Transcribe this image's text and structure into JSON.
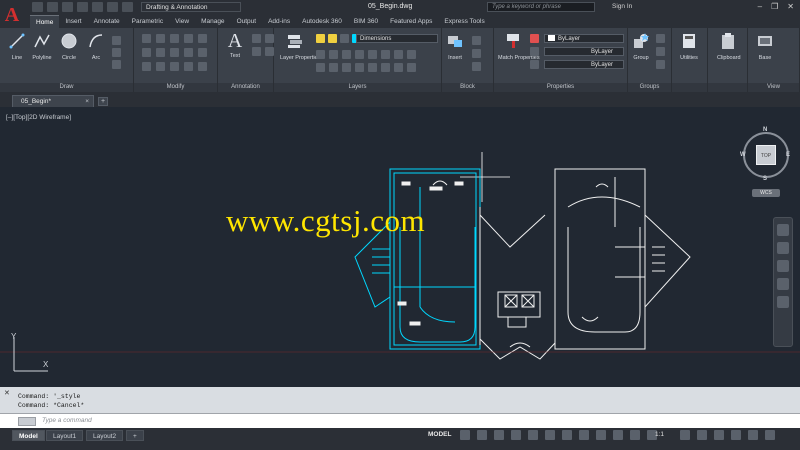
{
  "app": {
    "logo_letter": "A",
    "workspace": "Drafting & Annotation",
    "doc_title": "05_Begin.dwg",
    "search_placeholder": "Type a keyword or phrase",
    "signin": "Sign In",
    "window_controls": [
      "–",
      "❐",
      "✕"
    ]
  },
  "ribbon": {
    "tabs": [
      "Home",
      "Insert",
      "Annotate",
      "Parametric",
      "View",
      "Manage",
      "Output",
      "Add-ins",
      "Autodesk 360",
      "BIM 360",
      "Featured Apps",
      "Express Tools"
    ],
    "active_tab": "Home",
    "panels": {
      "draw": {
        "label": "Draw",
        "tools": [
          "Line",
          "Polyline",
          "Circle",
          "Arc"
        ]
      },
      "modify": {
        "label": "Modify"
      },
      "annotation": {
        "label": "Annotation",
        "tools": [
          "Text"
        ]
      },
      "layers": {
        "label": "Layers",
        "tools": [
          "Layer Properties"
        ],
        "current_layer": "Dimensions"
      },
      "block": {
        "label": "Block",
        "tools": [
          "Insert"
        ]
      },
      "properties": {
        "label": "Properties",
        "tools": [
          "Match Properties"
        ],
        "color": "ByLayer",
        "linetype": "ByLayer",
        "lineweight": "ByLayer"
      },
      "groups": {
        "label": "Groups",
        "tools": [
          "Group"
        ]
      },
      "utilities": {
        "label": "",
        "tools": [
          "Utilities"
        ]
      },
      "clipboard": {
        "label": "",
        "tools": [
          "Clipboard"
        ]
      },
      "view": {
        "label": "View",
        "tools": [
          "Base"
        ]
      }
    }
  },
  "file_tabs": {
    "active": "05_Begin*",
    "plus": "+"
  },
  "viewport": {
    "label": "[–][Top][2D Wireframe]",
    "watermark": "www.cgtsj.com",
    "viewcube": {
      "face": "TOP",
      "n": "N",
      "s": "S",
      "e": "E",
      "w": "W",
      "wcs": "WCS"
    },
    "ucs_x": "X",
    "ucs_y": "Y"
  },
  "command": {
    "history": [
      "Command: '_style",
      "Command: *Cancel*"
    ],
    "placeholder": "Type a command",
    "close_icon": "✕"
  },
  "statusbar": {
    "layout_tabs": [
      "Model",
      "Layout1",
      "Layout2"
    ],
    "plus": "+",
    "model_label": "MODEL",
    "scale": "1:1"
  },
  "colors": {
    "canvas": "#212832",
    "ribbon": "#3b414a",
    "titlebar": "#2b2f36",
    "accent_red": "#d32f2f",
    "watermark": "#ffe600",
    "drawing_cyan": "#00d8ff",
    "drawing_white": "#f0f0f0"
  }
}
